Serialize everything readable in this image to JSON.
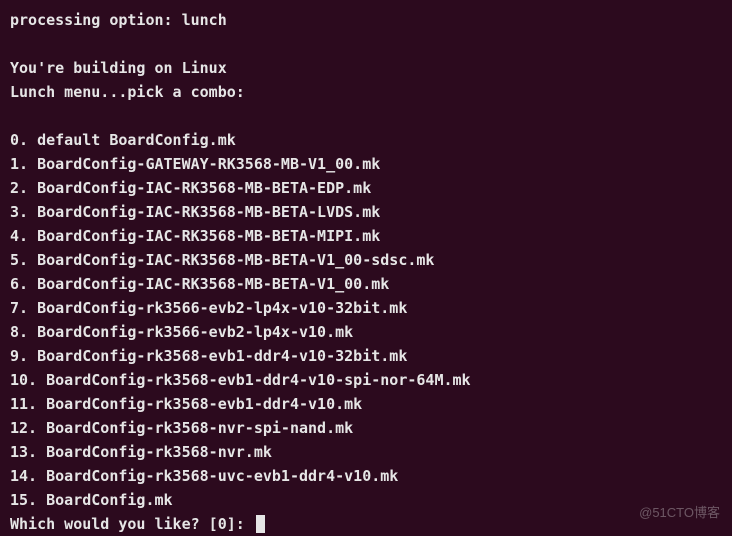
{
  "header": {
    "processing": "processing option: lunch",
    "build_line": "You're building on Linux",
    "menu_intro": "Lunch menu...pick a combo:"
  },
  "menu": {
    "items": [
      {
        "idx": "0",
        "label": "default BoardConfig.mk"
      },
      {
        "idx": "1",
        "label": "BoardConfig-GATEWAY-RK3568-MB-V1_00.mk"
      },
      {
        "idx": "2",
        "label": "BoardConfig-IAC-RK3568-MB-BETA-EDP.mk"
      },
      {
        "idx": "3",
        "label": "BoardConfig-IAC-RK3568-MB-BETA-LVDS.mk"
      },
      {
        "idx": "4",
        "label": "BoardConfig-IAC-RK3568-MB-BETA-MIPI.mk"
      },
      {
        "idx": "5",
        "label": "BoardConfig-IAC-RK3568-MB-BETA-V1_00-sdsc.mk"
      },
      {
        "idx": "6",
        "label": "BoardConfig-IAC-RK3568-MB-BETA-V1_00.mk"
      },
      {
        "idx": "7",
        "label": "BoardConfig-rk3566-evb2-lp4x-v10-32bit.mk"
      },
      {
        "idx": "8",
        "label": "BoardConfig-rk3566-evb2-lp4x-v10.mk"
      },
      {
        "idx": "9",
        "label": "BoardConfig-rk3568-evb1-ddr4-v10-32bit.mk"
      },
      {
        "idx": "10",
        "label": "BoardConfig-rk3568-evb1-ddr4-v10-spi-nor-64M.mk"
      },
      {
        "idx": "11",
        "label": "BoardConfig-rk3568-evb1-ddr4-v10.mk"
      },
      {
        "idx": "12",
        "label": "BoardConfig-rk3568-nvr-spi-nand.mk"
      },
      {
        "idx": "13",
        "label": "BoardConfig-rk3568-nvr.mk"
      },
      {
        "idx": "14",
        "label": "BoardConfig-rk3568-uvc-evb1-ddr4-v10.mk"
      },
      {
        "idx": "15",
        "label": "BoardConfig.mk"
      }
    ]
  },
  "prompt": {
    "question": "Which would you like? [0]: "
  },
  "watermark": "@51CTO博客"
}
